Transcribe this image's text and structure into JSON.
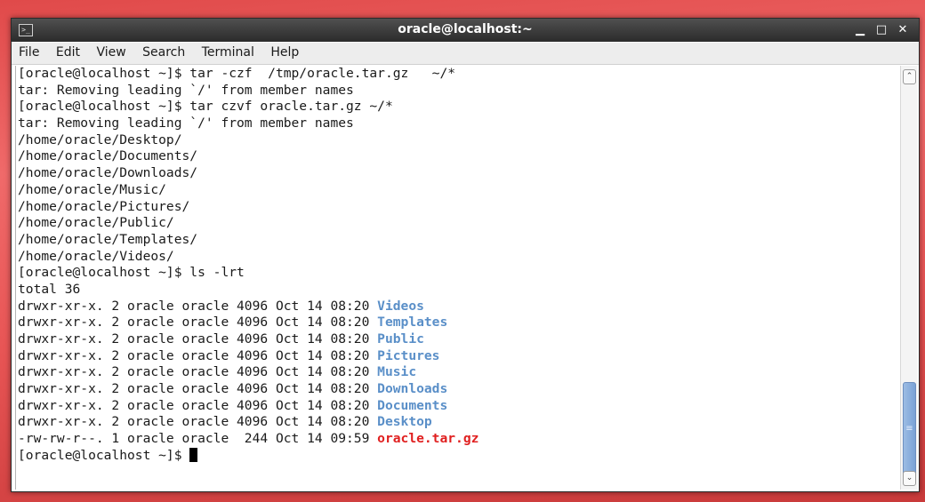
{
  "window": {
    "title": "oracle@localhost:~"
  },
  "menu": [
    "File",
    "Edit",
    "View",
    "Search",
    "Terminal",
    "Help"
  ],
  "terminal": {
    "lines": [
      {
        "text": "[oracle@localhost ~]$ tar -czf  /tmp/oracle.tar.gz   ~/*"
      },
      {
        "text": "tar: Removing leading `/' from member names"
      },
      {
        "text": "[oracle@localhost ~]$ tar czvf oracle.tar.gz ~/*"
      },
      {
        "text": "tar: Removing leading `/' from member names"
      },
      {
        "text": "/home/oracle/Desktop/"
      },
      {
        "text": "/home/oracle/Documents/"
      },
      {
        "text": "/home/oracle/Downloads/"
      },
      {
        "text": "/home/oracle/Music/"
      },
      {
        "text": "/home/oracle/Pictures/"
      },
      {
        "text": "/home/oracle/Public/"
      },
      {
        "text": "/home/oracle/Templates/"
      },
      {
        "text": "/home/oracle/Videos/"
      },
      {
        "text": "[oracle@localhost ~]$ ls -lrt"
      },
      {
        "text": "total 36"
      },
      {
        "text": "drwxr-xr-x. 2 oracle oracle 4096 Oct 14 08:20 ",
        "name": "Videos",
        "kind": "dir"
      },
      {
        "text": "drwxr-xr-x. 2 oracle oracle 4096 Oct 14 08:20 ",
        "name": "Templates",
        "kind": "dir"
      },
      {
        "text": "drwxr-xr-x. 2 oracle oracle 4096 Oct 14 08:20 ",
        "name": "Public",
        "kind": "dir"
      },
      {
        "text": "drwxr-xr-x. 2 oracle oracle 4096 Oct 14 08:20 ",
        "name": "Pictures",
        "kind": "dir"
      },
      {
        "text": "drwxr-xr-x. 2 oracle oracle 4096 Oct 14 08:20 ",
        "name": "Music",
        "kind": "dir"
      },
      {
        "text": "drwxr-xr-x. 2 oracle oracle 4096 Oct 14 08:20 ",
        "name": "Downloads",
        "kind": "dir"
      },
      {
        "text": "drwxr-xr-x. 2 oracle oracle 4096 Oct 14 08:20 ",
        "name": "Documents",
        "kind": "dir"
      },
      {
        "text": "drwxr-xr-x. 2 oracle oracle 4096 Oct 14 08:20 ",
        "name": "Desktop",
        "kind": "dir"
      },
      {
        "text": "-rw-rw-r--. 1 oracle oracle  244 Oct 14 09:59 ",
        "name": "oracle.tar.gz",
        "kind": "arch"
      },
      {
        "text": "[oracle@localhost ~]$ ",
        "cursor": true
      }
    ]
  },
  "colors": {
    "directory": "#5a8fc8",
    "archive": "#e02020",
    "desktop_background": "#e85555"
  },
  "icons": {
    "app": "terminal-icon",
    "minimize": "minimize-icon",
    "maximize": "maximize-icon",
    "close": "close-icon",
    "scroll_up": "chevron-up-icon",
    "scroll_down": "chevron-down-icon"
  }
}
